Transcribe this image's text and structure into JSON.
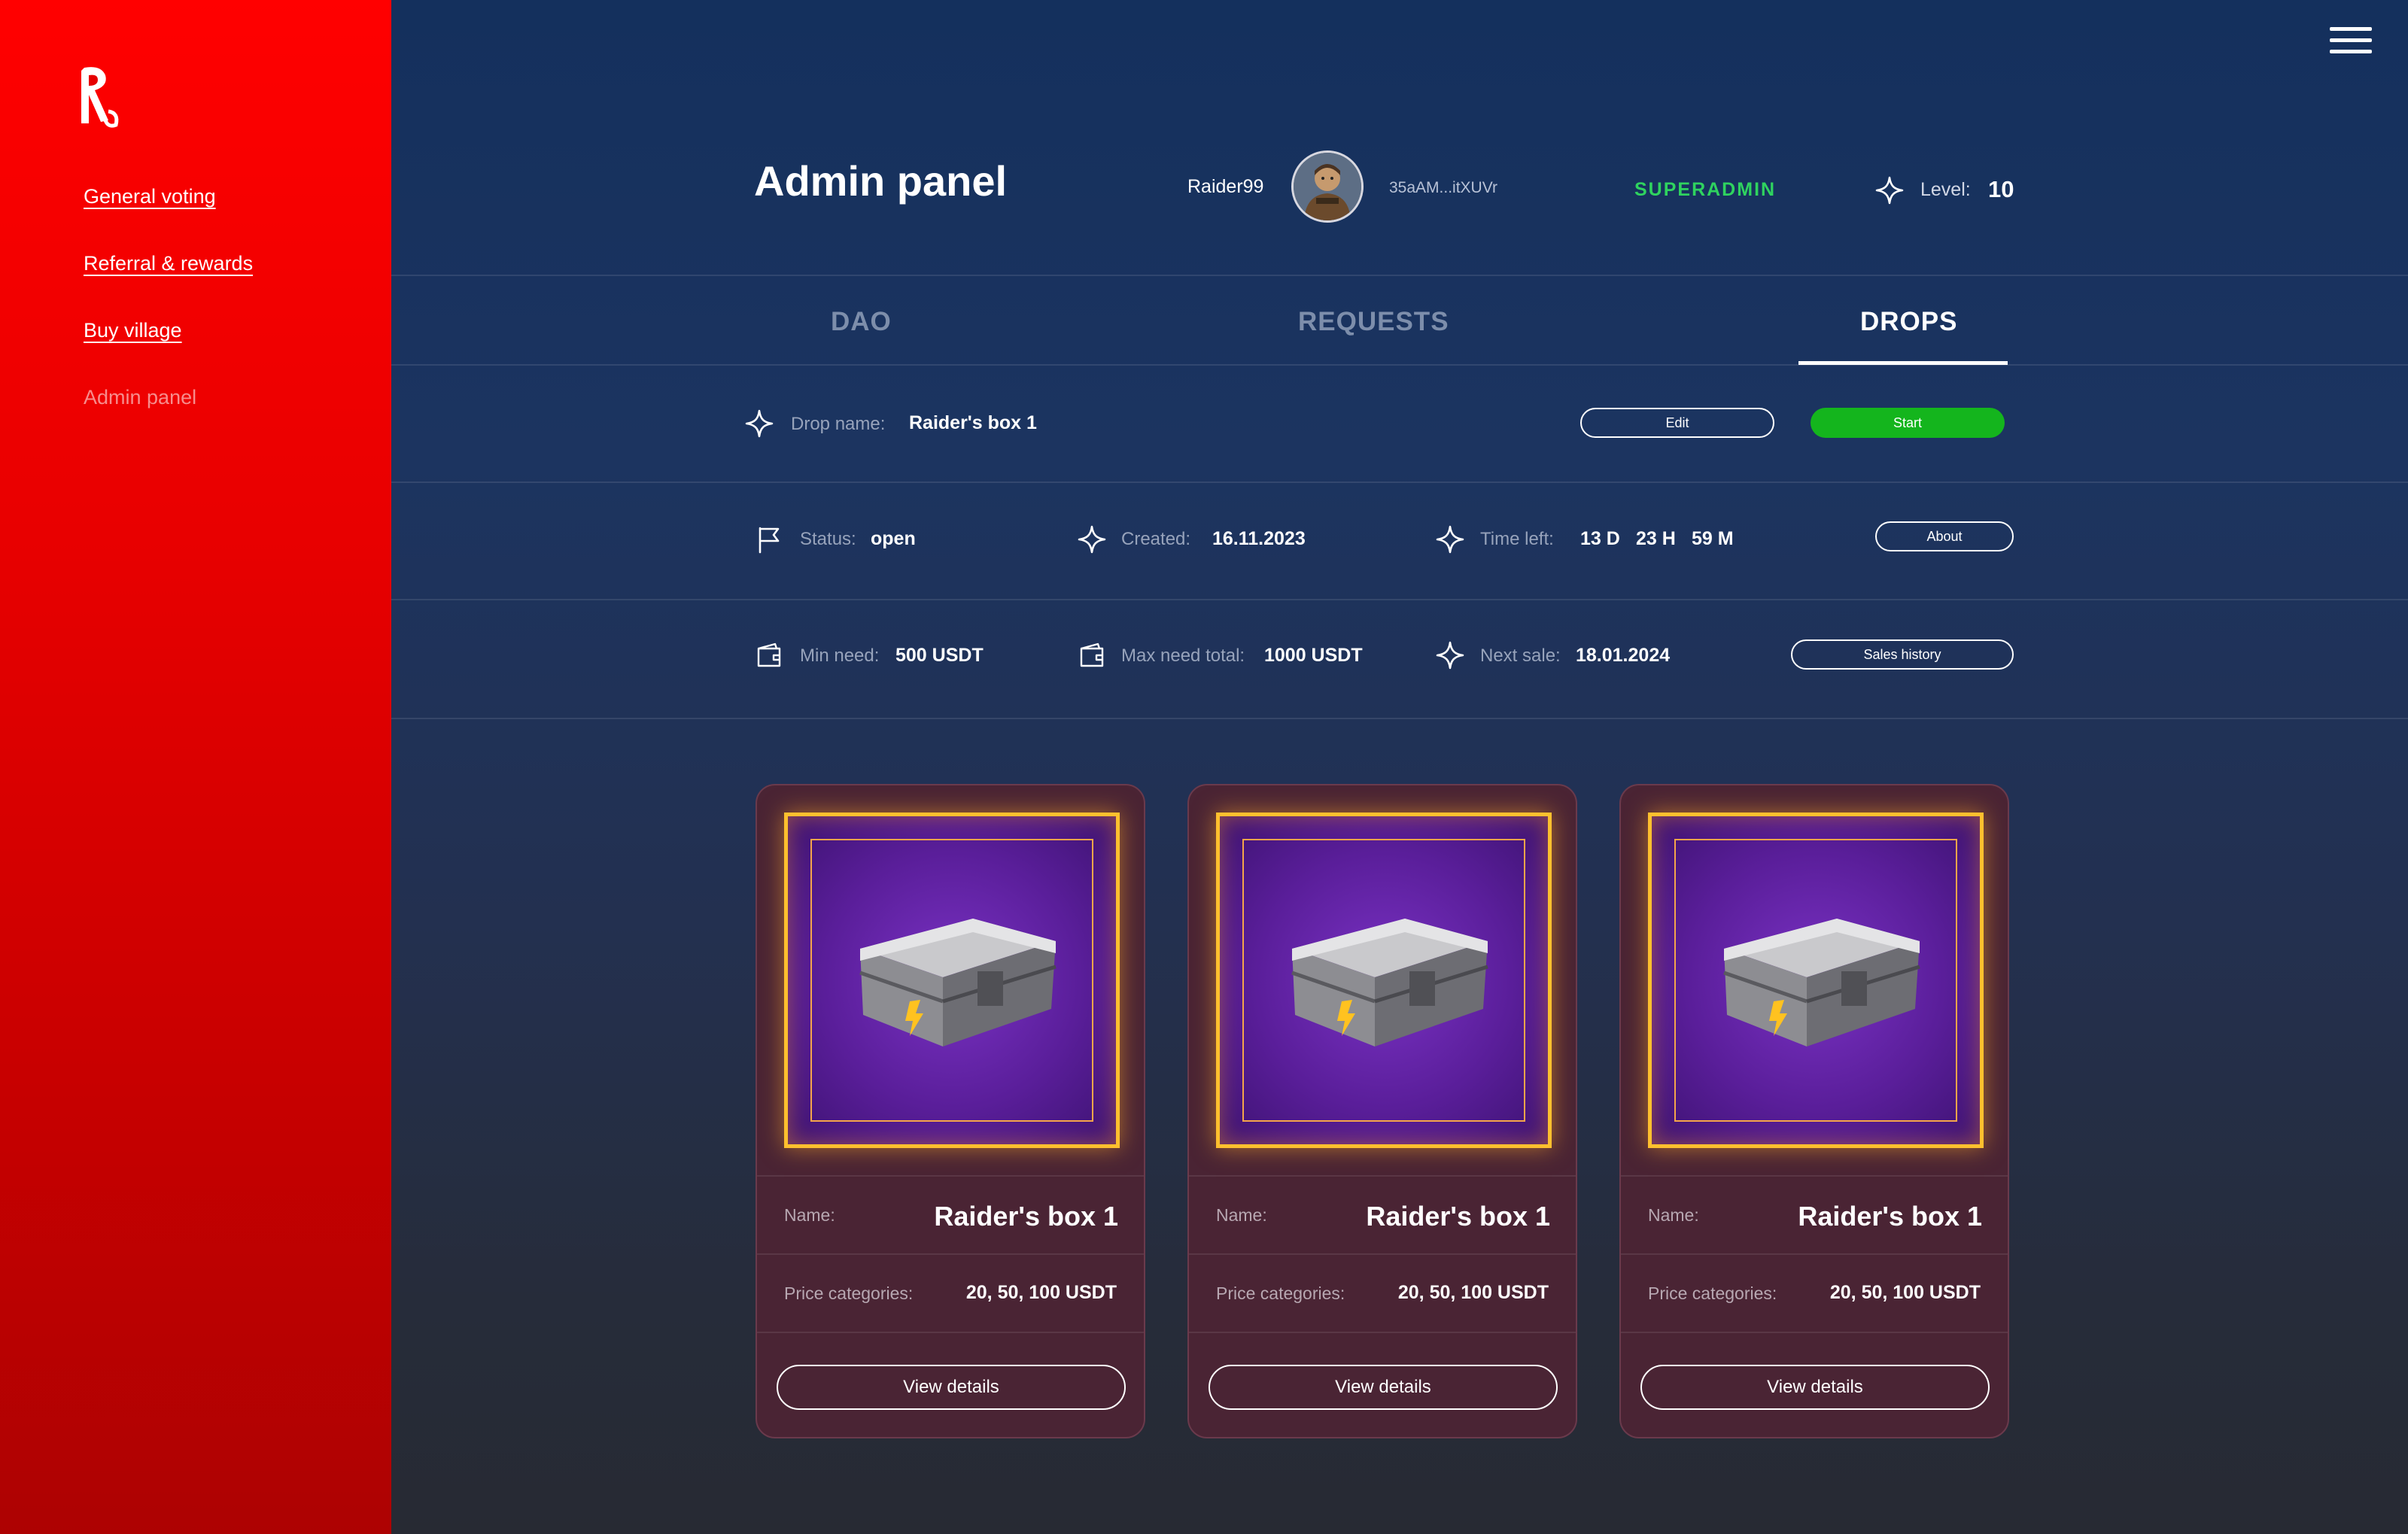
{
  "sidebar": {
    "items": [
      {
        "label": "General voting"
      },
      {
        "label": "Referral & rewards"
      },
      {
        "label": "Buy village"
      },
      {
        "label": "Admin panel"
      }
    ]
  },
  "header": {
    "title": "Admin panel",
    "username": "Raider99",
    "wallet": "35aAM...itXUVr",
    "role": "SUPERADMIN",
    "level_label": "Level:",
    "level_value": "10"
  },
  "tabs": [
    {
      "label": "DAO"
    },
    {
      "label": "REQUESTS"
    },
    {
      "label": "DROPS",
      "active": true
    }
  ],
  "drop": {
    "name_label": "Drop name:",
    "name": "Raider's box 1",
    "edit_label": "Edit",
    "start_label": "Start",
    "status_label": "Status:",
    "status": "open",
    "created_label": "Created:",
    "created": "16.11.2023",
    "time_left_label": "Time left:",
    "time_left_days": "13 D",
    "time_left_hours": "23 H",
    "time_left_minutes": "59 M",
    "about_label": "About",
    "min_need_label": "Min need:",
    "min_need": "500 USDT",
    "max_need_label": "Max need total:",
    "max_need": "1000 USDT",
    "next_sale_label": "Next sale:",
    "next_sale": "18.01.2024",
    "sales_history_label": "Sales history"
  },
  "cards": [
    {
      "name_label": "Name:",
      "name": "Raider's box 1",
      "price_label": "Price categories:",
      "price": "20, 50, 100 USDT",
      "button": "View details"
    },
    {
      "name_label": "Name:",
      "name": "Raider's box 1",
      "price_label": "Price categories:",
      "price": "20, 50, 100 USDT",
      "button": "View details"
    },
    {
      "name_label": "Name:",
      "name": "Raider's box 1",
      "price_label": "Price categories:",
      "price": "20, 50, 100 USDT",
      "button": "View details"
    }
  ],
  "icons": {
    "logo": "raider-logo-icon",
    "menu": "hamburger-menu-icon",
    "sparkle": "sparkle-icon",
    "flag": "flag-icon",
    "wallet": "wallet-icon",
    "chest": "treasure-chest-icon"
  },
  "colors": {
    "sidebar_red": "#ff0000",
    "main_navy": "#14305d",
    "role_green": "#2fd35f",
    "start_green": "#14b51d",
    "card_bg": "#4a2434",
    "card_frame_gold": "#ffc02e",
    "card_image_purple": "#5a1e9a"
  }
}
